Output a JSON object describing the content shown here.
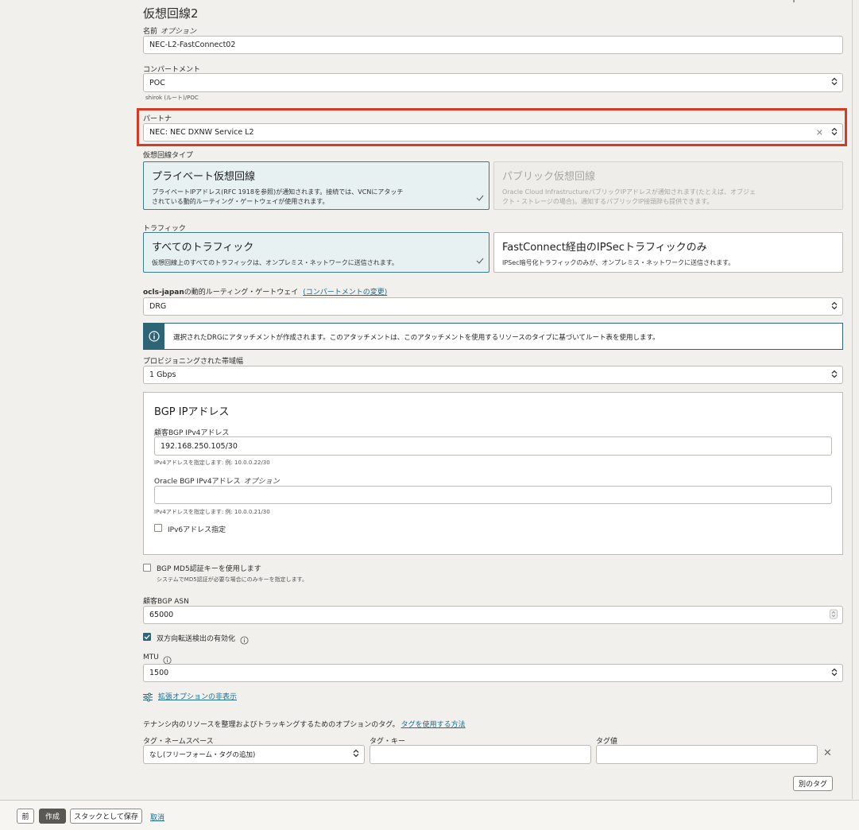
{
  "heading": "仮想回線2",
  "name_field": {
    "label": "名前",
    "optional": "オプション",
    "value": "NEC-L2-FastConnect02"
  },
  "compartment": {
    "label": "コンパートメント",
    "value": "POC",
    "path": "shirok (ルート)/POC"
  },
  "partner": {
    "label": "パートナ",
    "value": "NEC: NEC DXNW Service L2"
  },
  "circuit_type": {
    "label": "仮想回線タイプ",
    "private": {
      "title": "プライベート仮想回線",
      "desc1": "プライベートIPアドレス(RFC 1918を参照)が通知されます。接続では、VCNにアタッチ",
      "desc2": "されている動的ルーティング・ゲートウェイが使用されます。"
    },
    "public": {
      "title": "パブリック仮想回線",
      "desc1": "Oracle Cloud InfrastructureパブリックIPアドレスが通知されます(たとえば、オブジェ",
      "desc2": "クト・ストレージの場合)。通知するパブリックIP接頭辞も提供できます。"
    }
  },
  "traffic": {
    "label": "トラフィック",
    "all": {
      "title": "すべてのトラフィック",
      "desc": "仮想回線上のすべてのトラフィックは、オンプレミス・ネットワークに送信されます。"
    },
    "ipsec": {
      "title": "FastConnect経由のIPSecトラフィックのみ",
      "desc": "IPSec暗号化トラフィックのみが、オンプレミス・ネットワークに送信されます。"
    }
  },
  "drg": {
    "label_bold": "ocls-japan",
    "label_rest": "の動的ルーティング・ゲートウェイ",
    "change_link": "(コンパートメントの変更)",
    "value": "DRG"
  },
  "info_text": "選択されたDRGにアタッチメントが作成されます。このアタッチメントは、このアタッチメントを使用するリソースのタイプに基づいてルート表を使用します。",
  "bandwidth": {
    "label": "プロビジョニングされた帯域幅",
    "value": "1 Gbps"
  },
  "bgp": {
    "title": "BGP IPアドレス",
    "customer_label": "顧客BGP IPv4アドレス",
    "customer_value": "192.168.250.105/30",
    "customer_hint": "IPv4アドレスを指定します: 例: 10.0.0.22/30",
    "oracle_label": "Oracle BGP IPv4アドレス",
    "oracle_optional": "オプション",
    "oracle_value": "",
    "oracle_hint": "IPv4アドレスを指定します: 例: 10.0.0.21/30",
    "ipv6_label": "IPv6アドレス指定"
  },
  "md5": {
    "label": "BGP MD5認証キーを使用します",
    "hint": "システムでMD5認証が必要な場合にのみキーを指定します。"
  },
  "asn": {
    "label": "顧客BGP ASN",
    "value": "65000"
  },
  "bfd": {
    "label": "双方向転送検出の有効化"
  },
  "mtu": {
    "label": "MTU",
    "value": "1500"
  },
  "advanced_link": "拡張オプションの非表示",
  "tags": {
    "intro": "テナンシ内のリソースを整理およびトラッキングするためのオプションのタグ。",
    "intro_link": "タグを使用する方法",
    "namespace_label": "タグ・ネームスペース",
    "namespace_value": "なし(フリーフォーム・タグの追加)",
    "key_label": "タグ・キー",
    "value_label": "タグ値",
    "another_button": "別のタグ"
  },
  "footer": {
    "prev": "前",
    "create": "作成",
    "save_stack": "スタックとして保存",
    "cancel": "取消"
  },
  "colors": {
    "accent": "#2d6476",
    "highlight": "#d53a22",
    "link": "#1e6c8e"
  }
}
